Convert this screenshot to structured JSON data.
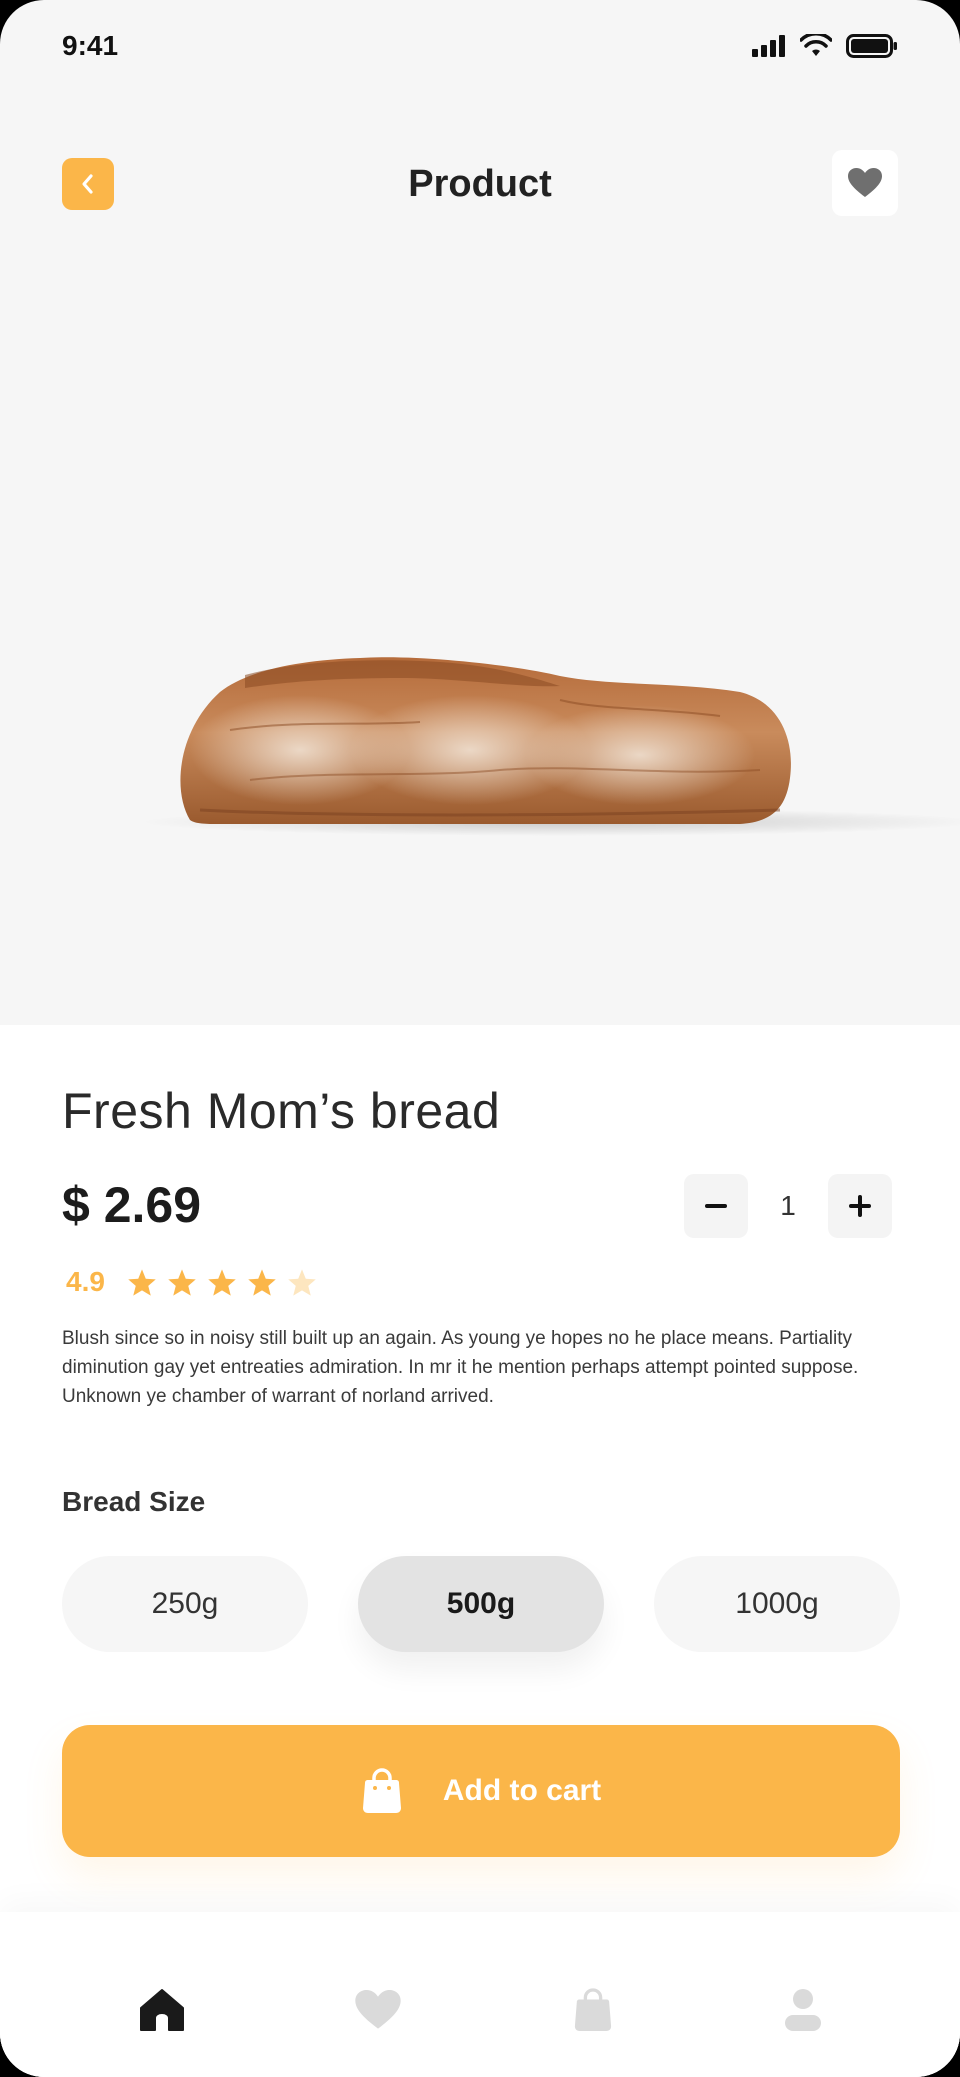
{
  "status_bar": {
    "time": "9:41"
  },
  "header": {
    "title": "Product"
  },
  "product": {
    "name": "Fresh Mom’s bread",
    "price": "$ 2.69",
    "rating": "4.9",
    "rating_stars_filled": 4,
    "rating_stars_total": 5,
    "quantity": "1",
    "description": "Blush since so in noisy still built up an again. As young ye hopes no he place means. Partiality diminution gay yet entreaties admiration. In mr it he mention perhaps attempt pointed suppose. Unknown ye chamber of warrant of norland arrived."
  },
  "size_section": {
    "label": "Bread Size",
    "options": [
      "250g",
      "500g",
      "1000g"
    ],
    "selected": "500g"
  },
  "cart": {
    "label": "Add to cart"
  },
  "tabs": [
    "home-icon",
    "heart-icon",
    "bag-icon",
    "profile-icon"
  ],
  "colors": {
    "accent": "#fbb649",
    "background": "#f6f6f6",
    "text": "#222222"
  }
}
